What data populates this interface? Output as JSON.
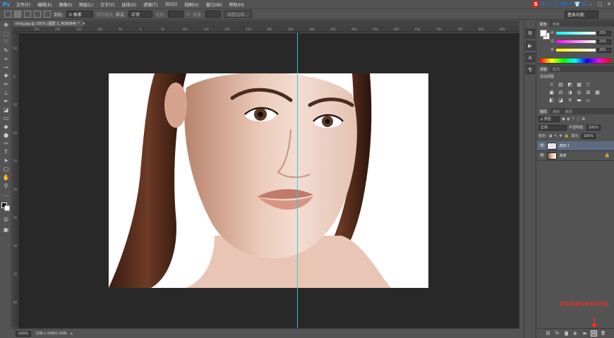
{
  "app": {
    "logo": "Ps"
  },
  "menu": [
    "文件(F)",
    "编辑(E)",
    "图像(I)",
    "图层(L)",
    "文字(Y)",
    "选择(S)",
    "滤镜(T)",
    "3D(D)",
    "视图(V)",
    "窗口(W)",
    "帮助(H)"
  ],
  "ime": {
    "logo": "S",
    "items": [
      "中",
      "丿",
      "☺",
      "⌨",
      "✉",
      "👕",
      "G"
    ]
  },
  "options": {
    "feather_label": "羽化:",
    "feather_value": "0 像素",
    "antialias_label": "消除锯齿",
    "style_label": "样式:",
    "style_value": "正常",
    "width_label": "宽度:",
    "height_label": "高度:",
    "refine_button": "调整边缘...",
    "workspace": "基本功能"
  },
  "document": {
    "tab_title": "timg.jpg @ 100% (图层 1, RGB/8#) *",
    "ruler_top": [
      "250",
      "200",
      "150",
      "100",
      "50",
      "0",
      "50",
      "100",
      "150",
      "200",
      "250",
      "300",
      "350",
      "400",
      "450",
      "500",
      "550",
      "600",
      "650",
      "700",
      "750",
      "800",
      "850"
    ],
    "ruler_left": [
      "50",
      "0",
      "50",
      "100",
      "150",
      "200",
      "250",
      "300",
      "350",
      "400"
    ]
  },
  "status": {
    "zoom": "100%",
    "doc_size": "文档:1.93M/1.93M"
  },
  "color_panel": {
    "tabs": [
      "颜色",
      "色板"
    ],
    "channels": [
      {
        "name": "R",
        "value": "255"
      },
      {
        "name": "G",
        "value": "255"
      },
      {
        "name": "B",
        "value": "255"
      }
    ]
  },
  "adjust_panel": {
    "tabs": [
      "调整",
      "样式"
    ],
    "title": "添加调整",
    "row1": [
      "☼",
      "▤",
      "◩",
      "▦",
      "▽"
    ],
    "row2": [
      "▣",
      "⚖",
      "◑",
      "◎",
      "⊞",
      "▦"
    ],
    "row3": [
      "◧",
      "◪",
      "✕",
      "▬",
      "▭"
    ]
  },
  "layers_panel": {
    "tabs": [
      "图层",
      "通道",
      "路径"
    ],
    "kind_label": "ρ 类型",
    "blend_mode": "正常",
    "opacity_label": "不透明度:",
    "opacity_value": "100%",
    "lock_label": "锁定:",
    "fill_label": "填充:",
    "fill_value": "100%",
    "layers": [
      {
        "name": "图层 1",
        "selected": true
      },
      {
        "name": "背景",
        "selected": false
      }
    ]
  },
  "annotation": {
    "text": "新建需要的使用的图层",
    "color": "#ff2a1e"
  }
}
